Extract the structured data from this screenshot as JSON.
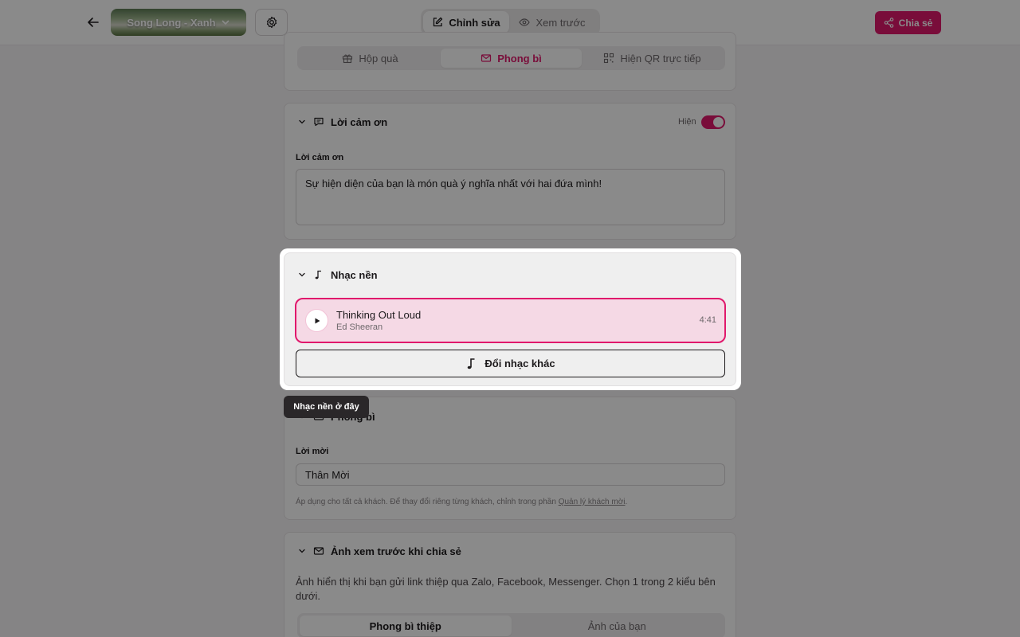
{
  "header": {
    "template_name": "Song Long - Xanh",
    "mode_tabs": [
      {
        "label": "Chỉnh sửa",
        "active": true
      },
      {
        "label": "Xem trước",
        "active": false
      }
    ],
    "share_label": "Chia sẻ"
  },
  "gift_card": {
    "options": [
      {
        "label": "Hộp quà",
        "active": false
      },
      {
        "label": "Phong bì",
        "active": true
      },
      {
        "label": "Hiện QR trực tiếp",
        "active": false
      }
    ]
  },
  "thanks_card": {
    "title": "Lời cảm ơn",
    "visibility_label": "Hiện",
    "visible": true,
    "field_label": "Lời cảm ơn",
    "message": "Sự hiện diện của bạn là món quà ý nghĩa nhất với hai đứa mình!"
  },
  "music_card": {
    "title": "Nhạc nền",
    "track_title": "Thinking Out Loud",
    "track_artist": "Ed Sheeran",
    "track_duration": "4:41",
    "change_label": "Đổi nhạc khác"
  },
  "tooltip": {
    "text": "Nhạc nền ở đây"
  },
  "envelope_card": {
    "title": "Phong bì",
    "field_label": "Lời mời",
    "value": "Thân Mời",
    "hint_prefix": "Áp dụng cho tất cả khách. Để thay đổi riêng từng khách, chỉnh trong phần ",
    "hint_link": "Quản lý khách mời",
    "hint_suffix": "."
  },
  "preview_card": {
    "title": "Ảnh xem trước khi chia sẻ",
    "description": "Ảnh hiển thị khi bạn gửi link thiệp qua Zalo, Facebook, Messenger. Chọn 1 trong 2 kiểu bên dưới.",
    "options": [
      {
        "label": "Phong bì thiệp",
        "active": true
      },
      {
        "label": "Ảnh của bạn",
        "active": false
      }
    ]
  },
  "colors": {
    "accent": "#e0196c",
    "track_bg": "#f5d9e5"
  }
}
